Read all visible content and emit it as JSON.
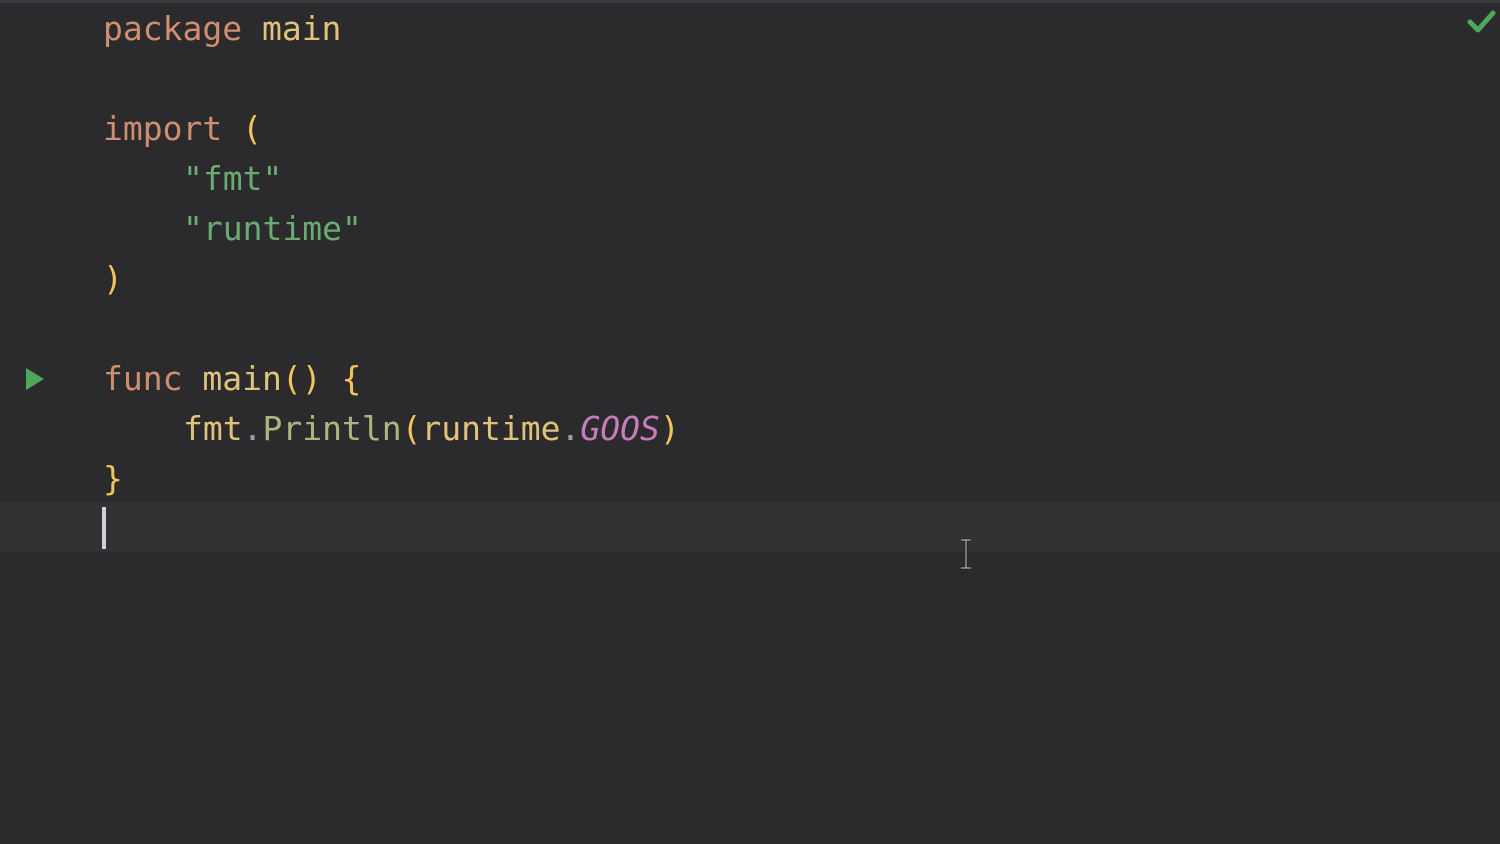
{
  "editor": {
    "language": "Go",
    "status_icon": "check-icon",
    "run_icon": "run-triangle-icon",
    "lines": [
      {
        "package_kw": "package",
        "package_name": "main"
      },
      {
        "import_kw": "import",
        "open_paren": "("
      },
      {
        "import_fmt": "\"fmt\""
      },
      {
        "import_runtime": "\"runtime\""
      },
      {
        "close_paren": ")"
      },
      {
        "func_kw": "func",
        "func_name": "main",
        "parens": "()",
        "open_brace": "{"
      },
      {
        "pkg": "fmt",
        "dot1": ".",
        "call": "Println",
        "lp": "(",
        "arg_pkg": "runtime",
        "dot2": ".",
        "arg_const": "GOOS",
        "rp": ")"
      },
      {
        "close_brace": "}"
      }
    ],
    "colors": {
      "background": "#2b2b2d",
      "keyword": "#cf8e6d",
      "string": "#6aab73",
      "brace": "#f2c55c",
      "constant": "#c77dbb",
      "ok_check": "#4ea75a",
      "run_icon": "#4ea75a"
    }
  }
}
